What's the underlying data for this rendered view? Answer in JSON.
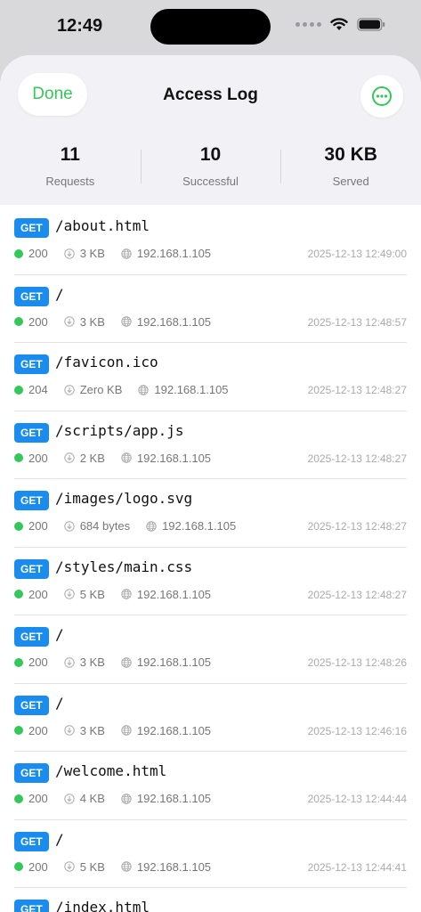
{
  "status_bar": {
    "time": "12:49"
  },
  "header": {
    "done_label": "Done",
    "title": "Access Log",
    "stats": [
      {
        "value": "11",
        "label": "Requests"
      },
      {
        "value": "10",
        "label": "Successful"
      },
      {
        "value": "30 KB",
        "label": "Served"
      }
    ]
  },
  "colors": {
    "accent": "#34c759",
    "method_badge": "#1a8cf0"
  },
  "entries": [
    {
      "method": "GET",
      "path": "/about.html",
      "status": "200",
      "size": "3 KB",
      "ip": "192.168.1.105",
      "time": "2025-12-13 12:49:00"
    },
    {
      "method": "GET",
      "path": "/",
      "status": "200",
      "size": "3 KB",
      "ip": "192.168.1.105",
      "time": "2025-12-13 12:48:57"
    },
    {
      "method": "GET",
      "path": "/favicon.ico",
      "status": "204",
      "size": "Zero KB",
      "ip": "192.168.1.105",
      "time": "2025-12-13 12:48:27"
    },
    {
      "method": "GET",
      "path": "/scripts/app.js",
      "status": "200",
      "size": "2 KB",
      "ip": "192.168.1.105",
      "time": "2025-12-13 12:48:27"
    },
    {
      "method": "GET",
      "path": "/images/logo.svg",
      "status": "200",
      "size": "684 bytes",
      "ip": "192.168.1.105",
      "time": "2025-12-13 12:48:27"
    },
    {
      "method": "GET",
      "path": "/styles/main.css",
      "status": "200",
      "size": "5 KB",
      "ip": "192.168.1.105",
      "time": "2025-12-13 12:48:27"
    },
    {
      "method": "GET",
      "path": "/",
      "status": "200",
      "size": "3 KB",
      "ip": "192.168.1.105",
      "time": "2025-12-13 12:48:26"
    },
    {
      "method": "GET",
      "path": "/",
      "status": "200",
      "size": "3 KB",
      "ip": "192.168.1.105",
      "time": "2025-12-13 12:46:16"
    },
    {
      "method": "GET",
      "path": "/welcome.html",
      "status": "200",
      "size": "4 KB",
      "ip": "192.168.1.105",
      "time": "2025-12-13 12:44:44"
    },
    {
      "method": "GET",
      "path": "/",
      "status": "200",
      "size": "5 KB",
      "ip": "192.168.1.105",
      "time": "2025-12-13 12:44:41"
    },
    {
      "method": "GET",
      "path": "/index.html",
      "status": "",
      "size": "",
      "ip": "",
      "time": ""
    }
  ]
}
